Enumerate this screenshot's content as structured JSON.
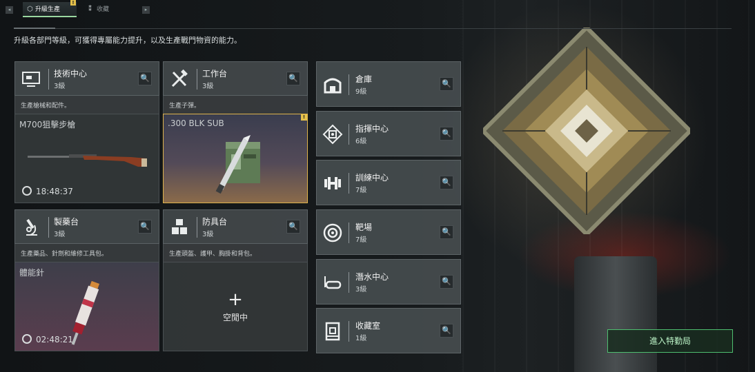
{
  "top_tabs": {
    "left_nav_glyph": "◂",
    "right_nav_glyph": "▸",
    "items": [
      {
        "label": "升級生產",
        "icon": "hex-gear-icon",
        "active": true,
        "alert": "!"
      },
      {
        "label": "收藏",
        "icon": "collection-icon",
        "active": false
      }
    ]
  },
  "description": "升級各部門等級，可獲得專屬能力提升，以及生產戰門物資的能力。",
  "production_cards": [
    {
      "title": "技術中心",
      "level": "3級",
      "subtitle": "生產槍械和配件。",
      "item_name": "M700狙擊步槍",
      "timer": "18:48:37",
      "icon": "computer-icon"
    },
    {
      "title": "工作台",
      "level": "3級",
      "subtitle": "生產子彈。",
      "item_name": ".300 BLK SUB",
      "icon": "tools-icon",
      "alert": "!"
    },
    {
      "title": "製藥台",
      "level": "3級",
      "subtitle": "生產藥品、針劑和維修工具包。",
      "item_name": "體能針",
      "timer": "02:48:21",
      "icon": "microscope-icon"
    },
    {
      "title": "防具台",
      "level": "3級",
      "subtitle": "生產頭盔、護甲、胸掛和背包。",
      "empty_label": "空閒中",
      "plus": "+",
      "icon": "armor-blocks-icon"
    }
  ],
  "facilities": [
    {
      "title": "倉庫",
      "level": "9級",
      "icon": "warehouse-icon"
    },
    {
      "title": "指揮中心",
      "level": "6級",
      "icon": "command-chip-icon"
    },
    {
      "title": "訓練中心",
      "level": "7級",
      "icon": "dumbbell-icon"
    },
    {
      "title": "靶場",
      "level": "7級",
      "icon": "target-icon"
    },
    {
      "title": "潛水中心",
      "level": "3級",
      "icon": "diving-mask-icon"
    },
    {
      "title": "收藏室",
      "level": "1級",
      "icon": "display-case-icon"
    }
  ],
  "search_glyph": "🔍",
  "enter_button": "進入特勤局",
  "colors": {
    "accent_green": "#4fbf70",
    "alert_yellow": "#e4c04a",
    "highlight_border": "#e0b44c"
  }
}
